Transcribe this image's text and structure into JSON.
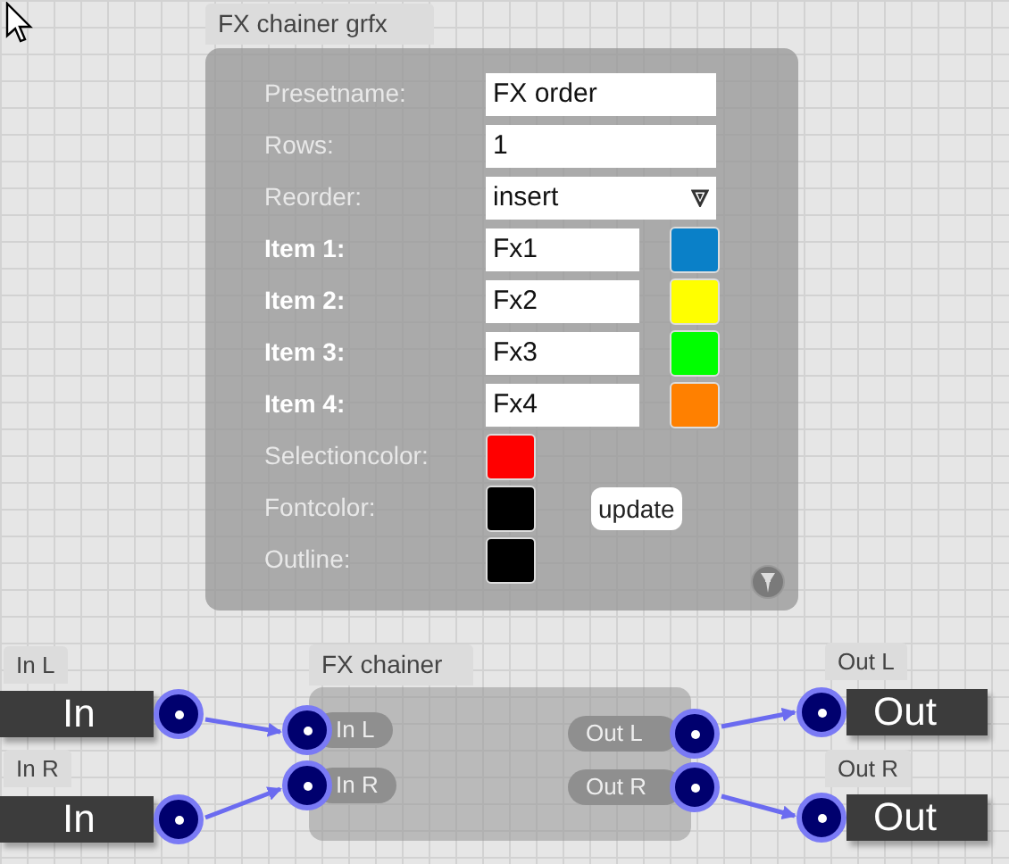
{
  "preset_node": {
    "title": "FX chainer grfx",
    "rows": [
      {
        "kind": "text",
        "label": "Presetname:",
        "value": "FX order"
      },
      {
        "kind": "text",
        "label": "Rows:",
        "value": "1"
      },
      {
        "kind": "select",
        "label": "Reorder:",
        "value": "insert"
      },
      {
        "kind": "item",
        "label": "Item 1:",
        "value": "Fx1",
        "color": "#0a80c8"
      },
      {
        "kind": "item",
        "label": "Item 2:",
        "value": "Fx2",
        "color": "#ffff00"
      },
      {
        "kind": "item",
        "label": "Item 3:",
        "value": "Fx3",
        "color": "#00ff00"
      },
      {
        "kind": "item",
        "label": "Item 4:",
        "value": "Fx4",
        "color": "#ff8000"
      },
      {
        "kind": "color",
        "label": "Selectioncolor:",
        "color": "#ff0000"
      },
      {
        "kind": "color",
        "label": "Fontcolor:",
        "color": "#000000",
        "button": "update"
      },
      {
        "kind": "color",
        "label": "Outline:",
        "color": "#000000"
      }
    ]
  },
  "io_nodes": [
    {
      "kind": "input",
      "tab": "In L",
      "label": "In"
    },
    {
      "kind": "input",
      "tab": "In R",
      "label": "In"
    },
    {
      "kind": "output",
      "tab": "Out L",
      "label": "Out"
    },
    {
      "kind": "output",
      "tab": "Out R",
      "label": "Out"
    }
  ],
  "fx_node": {
    "title": "FX chainer",
    "inputs": [
      "In L",
      "In R"
    ],
    "outputs": [
      "Out L",
      "Out R"
    ]
  }
}
